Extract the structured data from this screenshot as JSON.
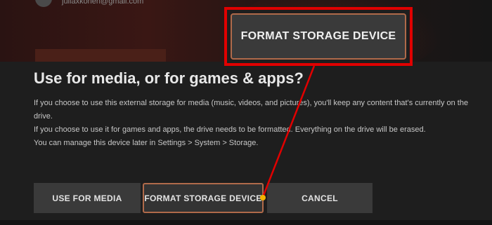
{
  "account": {
    "email": "juliaxkohen@gmail.com"
  },
  "dialog": {
    "title": "Use for media, or for games & apps?",
    "paragraphs": [
      "If you choose to use this external storage for media (music, videos, and pictures), you'll keep any content that's currently on the drive.",
      "If you choose to use it for games and apps, the drive needs to be formatted. Everything on the drive will be erased.",
      "You can manage this device later in Settings > System > Storage."
    ],
    "buttons": {
      "use_for_media": "USE FOR MEDIA",
      "format_storage": "FORMAT STORAGE DEVICE",
      "cancel": "CANCEL"
    }
  },
  "callout": {
    "label": "FORMAT STORAGE DEVICE",
    "border_color": "#e10000",
    "pointer_dot_color": "#f5b400"
  }
}
